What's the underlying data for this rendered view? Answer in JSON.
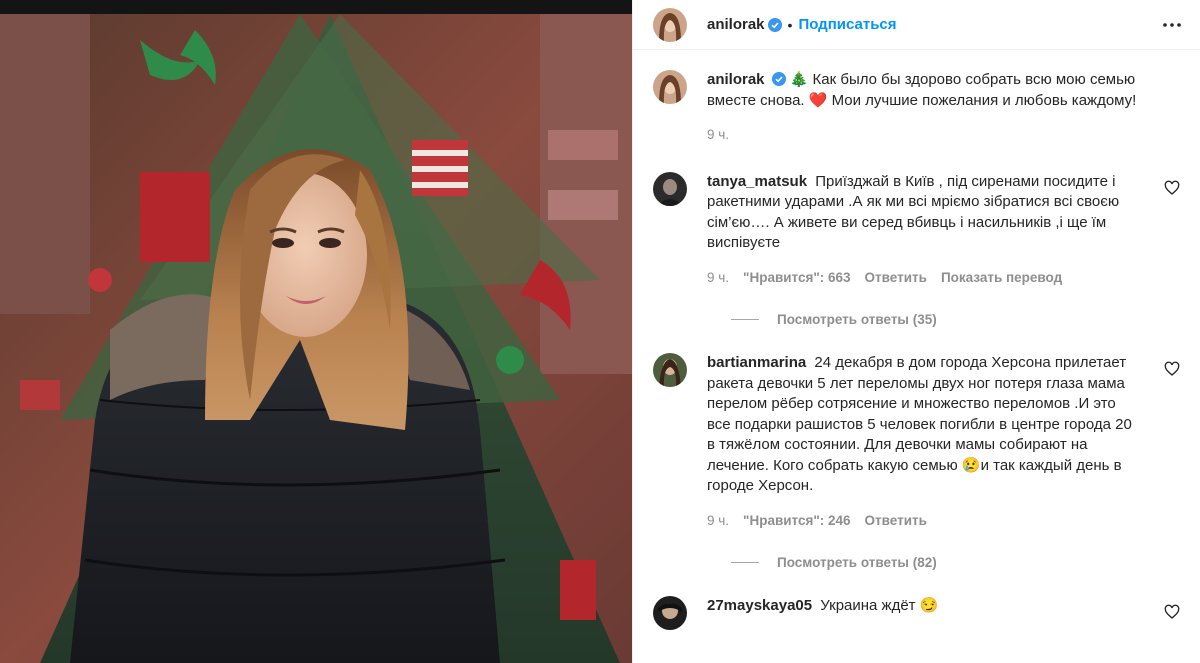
{
  "post": {
    "author": "anilorak",
    "follow_label": "Подписаться",
    "caption_text": "🎄 Как было бы здорово собрать всю мою семью вместе снова. ❤️ Мои лучшие пожелания и любовь каждому!",
    "time": "9 ч."
  },
  "comments": [
    {
      "user": "tanya_matsuk",
      "text": "Приїзджай в Київ , під сиренами посидите і ракетними ударами .А як ми всі мріємо зібратися всі своєю сім’єю…. А живете ви серед вбивць і насильників ,і ще їм виспівуєте",
      "time": "9 ч.",
      "likes": "\"Нравится\": 663",
      "reply_label": "Ответить",
      "translate_label": "Показать перевод",
      "view_replies": "Посмотреть ответы (35)"
    },
    {
      "user": "bartianmarina",
      "text": "24 декабря в дом города Херсона прилетает ракета девочки 5 лет переломы двух ног потеря глаза мама перелом рёбер сотрясение и множество переломов .И это все подарки рашистов 5 человек погибли в центре города 20 в тяжёлом состоянии. Для девочки мамы собирают на лечение. Кого собрать какую семью 😢и так каждый день в городе Херсон.",
      "time": "9 ч.",
      "likes": "\"Нравится\": 246",
      "reply_label": "Ответить",
      "view_replies": "Посмотреть ответы (82)"
    },
    {
      "user": "27mayskaya05",
      "text": "Украина ждёт 😏"
    }
  ],
  "icons": {
    "verified": "verified-badge-icon",
    "more": "more-options-icon",
    "like": "heart-outline-icon"
  },
  "colors": {
    "link_blue": "#0095f6",
    "verified_blue": "#3897f0",
    "muted": "#8e8e8e"
  }
}
